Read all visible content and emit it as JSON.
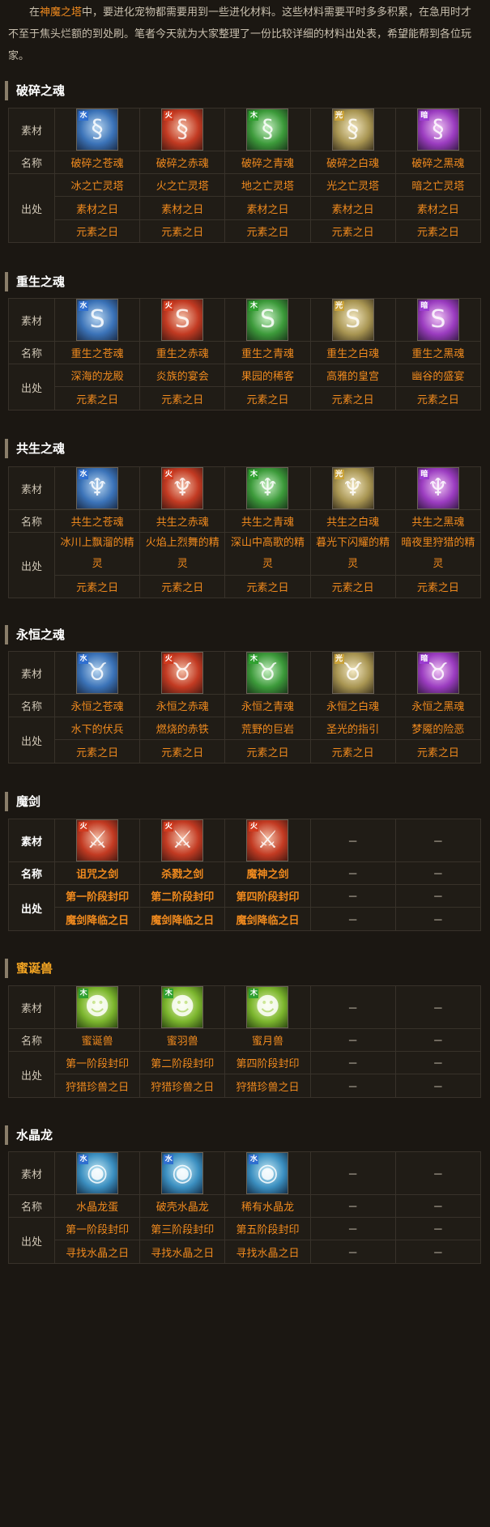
{
  "intro": {
    "text_before": "在",
    "highlight": "神魔之塔",
    "text_after": "中，要进化宠物都需要用到一些进化材料。这些材料需要平时多多积累，在急用时才不至于焦头烂额的到处刷。笔者今天就为大家整理了一份比较详细的材料出处表，希望能帮到各位玩家。"
  },
  "labels": {
    "material": "素材",
    "name": "名称",
    "source": "出处",
    "dash": "－"
  },
  "sections": [
    {
      "title": "破碎之魂",
      "icons": [
        {
          "name": "blue-dragon-soul-icon",
          "color": "blue",
          "glyph": "§",
          "badge": "水"
        },
        {
          "name": "red-dragon-soul-icon",
          "color": "red",
          "glyph": "§",
          "badge": "火"
        },
        {
          "name": "green-dragon-soul-icon",
          "color": "green",
          "glyph": "§",
          "badge": "木"
        },
        {
          "name": "gold-dragon-soul-icon",
          "color": "gold",
          "glyph": "§",
          "badge": "光"
        },
        {
          "name": "purple-dragon-soul-icon",
          "color": "purple",
          "glyph": "§",
          "badge": "暗"
        }
      ],
      "names": [
        "破碎之苍魂",
        "破碎之赤魂",
        "破碎之青魂",
        "破碎之白魂",
        "破碎之黑魂"
      ],
      "sources": [
        [
          "冰之亡灵塔",
          "火之亡灵塔",
          "地之亡灵塔",
          "光之亡灵塔",
          "暗之亡灵塔"
        ],
        [
          "素材之日",
          "素材之日",
          "素材之日",
          "素材之日",
          "素材之日"
        ],
        [
          "元素之日",
          "元素之日",
          "元素之日",
          "元素之日",
          "元素之日"
        ]
      ]
    },
    {
      "title": "重生之魂",
      "icons": [
        {
          "name": "blue-rebirth-soul-icon",
          "color": "blue",
          "glyph": "S",
          "badge": "水"
        },
        {
          "name": "red-rebirth-soul-icon",
          "color": "red",
          "glyph": "S",
          "badge": "火"
        },
        {
          "name": "green-rebirth-soul-icon",
          "color": "green",
          "glyph": "S",
          "badge": "木"
        },
        {
          "name": "gold-rebirth-soul-icon",
          "color": "gold",
          "glyph": "S",
          "badge": "光"
        },
        {
          "name": "purple-rebirth-soul-icon",
          "color": "purple",
          "glyph": "S",
          "badge": "暗"
        }
      ],
      "names": [
        "重生之苍魂",
        "重生之赤魂",
        "重生之青魂",
        "重生之白魂",
        "重生之黑魂"
      ],
      "sources": [
        [
          "深海的龙殿",
          "炎族的宴会",
          "果园的稀客",
          "高雅的皇宫",
          "幽谷的盛宴"
        ],
        [
          "元素之日",
          "元素之日",
          "元素之日",
          "元素之日",
          "元素之日"
        ]
      ]
    },
    {
      "title": "共生之魂",
      "icons": [
        {
          "name": "blue-symbiosis-soul-icon",
          "color": "blue",
          "glyph": "♆",
          "badge": "水"
        },
        {
          "name": "red-symbiosis-soul-icon",
          "color": "red",
          "glyph": "♆",
          "badge": "火"
        },
        {
          "name": "green-symbiosis-soul-icon",
          "color": "green",
          "glyph": "♆",
          "badge": "木"
        },
        {
          "name": "gold-symbiosis-soul-icon",
          "color": "gold",
          "glyph": "♆",
          "badge": "光"
        },
        {
          "name": "purple-symbiosis-soul-icon",
          "color": "purple",
          "glyph": "♆",
          "badge": "暗"
        }
      ],
      "names": [
        "共生之苍魂",
        "共生之赤魂",
        "共生之青魂",
        "共生之白魂",
        "共生之黑魂"
      ],
      "sources": [
        [
          "冰川上飘溜的精灵",
          "火焰上烈舞的精灵",
          "深山中高歌的精灵",
          "暮光下闪耀的精灵",
          "暗夜里狩猎的精灵"
        ],
        [
          "元素之日",
          "元素之日",
          "元素之日",
          "元素之日",
          "元素之日"
        ]
      ]
    },
    {
      "title": "永恒之魂",
      "icons": [
        {
          "name": "blue-eternal-soul-icon",
          "color": "blue",
          "glyph": "♉",
          "badge": "水"
        },
        {
          "name": "red-eternal-soul-icon",
          "color": "red",
          "glyph": "♉",
          "badge": "火"
        },
        {
          "name": "green-eternal-soul-icon",
          "color": "green",
          "glyph": "♉",
          "badge": "木"
        },
        {
          "name": "gold-eternal-soul-icon",
          "color": "gold",
          "glyph": "♉",
          "badge": "光"
        },
        {
          "name": "purple-eternal-soul-icon",
          "color": "purple",
          "glyph": "♉",
          "badge": "暗"
        }
      ],
      "names": [
        "永恒之苍魂",
        "永恒之赤魂",
        "永恒之青魂",
        "永恒之白魂",
        "永恒之黑魂"
      ],
      "sources": [
        [
          "水下的伏兵",
          "燃烧的赤铁",
          "荒野的巨岩",
          "圣光的指引",
          "梦魇的险恶"
        ],
        [
          "元素之日",
          "元素之日",
          "元素之日",
          "元素之日",
          "元素之日"
        ]
      ]
    },
    {
      "title": "魔剑",
      "icons": [
        {
          "name": "cursed-sword-icon",
          "color": "red",
          "glyph": "⚔",
          "badge": "火"
        },
        {
          "name": "killing-sword-icon",
          "color": "red",
          "glyph": "⚔",
          "badge": "火"
        },
        {
          "name": "demon-god-sword-icon",
          "color": "red",
          "glyph": "⚔",
          "badge": "火"
        }
      ],
      "names": [
        "诅咒之剑",
        "杀戮之剑",
        "魔神之剑",
        "－",
        "－"
      ],
      "sources": [
        [
          "第一阶段封印",
          "第二阶段封印",
          "第四阶段封印",
          "－",
          "－"
        ],
        [
          "魔剑降临之日",
          "魔剑降临之日",
          "魔剑降临之日",
          "－",
          "－"
        ]
      ]
    },
    {
      "title": "蜜诞兽",
      "icons": [
        {
          "name": "honey-beast-icon",
          "color": "lime",
          "glyph": "☻",
          "badge": "木"
        },
        {
          "name": "honey-feather-beast-icon",
          "color": "lime",
          "glyph": "☻",
          "badge": "木"
        },
        {
          "name": "honey-moon-beast-icon",
          "color": "lime",
          "glyph": "☻",
          "badge": "木"
        }
      ],
      "names": [
        "蜜诞兽",
        "蜜羽兽",
        "蜜月兽",
        "－",
        "－"
      ],
      "sources": [
        [
          "第一阶段封印",
          "第二阶段封印",
          "第四阶段封印",
          "－",
          "－"
        ],
        [
          "狩猎珍兽之日",
          "狩猎珍兽之日",
          "狩猎珍兽之日",
          "－",
          "－"
        ]
      ]
    },
    {
      "title": "水晶龙",
      "icons": [
        {
          "name": "crystal-dragon-egg-icon",
          "color": "aqua",
          "glyph": "◉",
          "badge": "水"
        },
        {
          "name": "hatched-crystal-dragon-icon",
          "color": "aqua",
          "glyph": "◉",
          "badge": "水"
        },
        {
          "name": "rare-crystal-dragon-icon",
          "color": "aqua",
          "glyph": "◉",
          "badge": "水"
        }
      ],
      "names": [
        "水晶龙蛋",
        "破壳水晶龙",
        "稀有水晶龙",
        "－",
        "－"
      ],
      "sources": [
        [
          "第一阶段封印",
          "第三阶段封印",
          "第五阶段封印",
          "－",
          "－"
        ],
        [
          "寻找水晶之日",
          "寻找水晶之日",
          "寻找水晶之日",
          "－",
          "－"
        ]
      ]
    }
  ]
}
